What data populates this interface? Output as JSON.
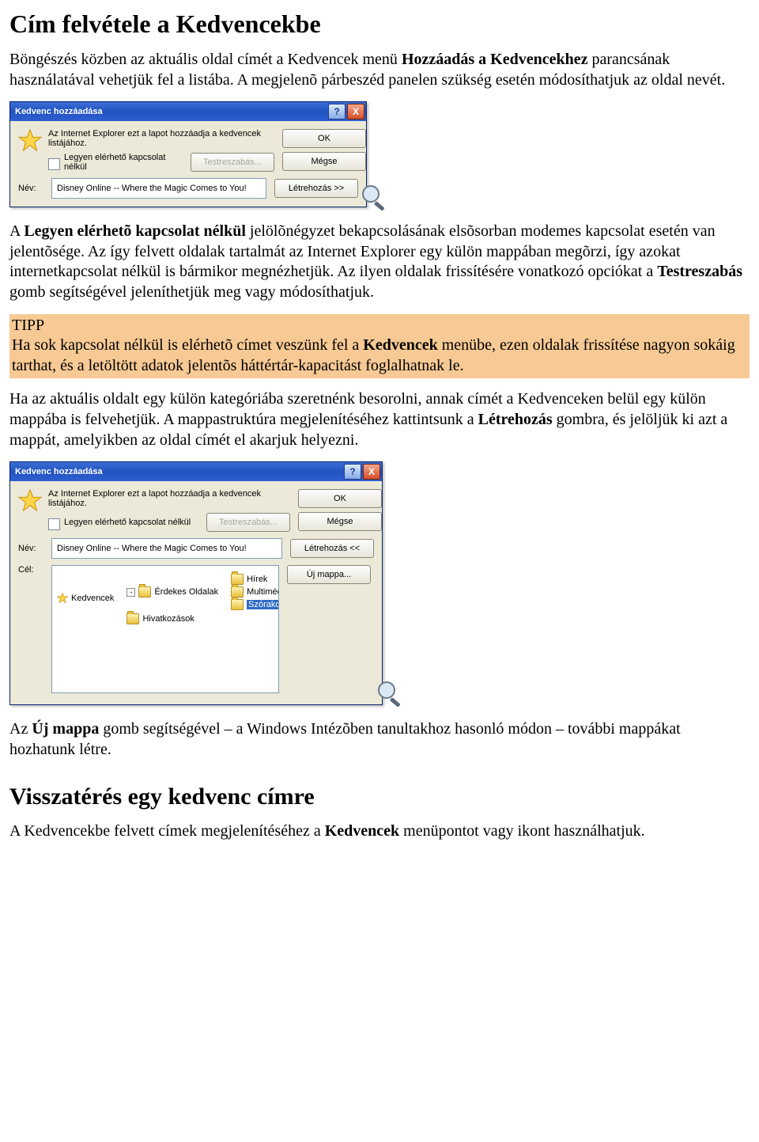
{
  "heading1": "Cím felvétele a Kedvencekbe",
  "para1_a": "Böngészés közben az aktuális oldal címét a Kedvencek menü ",
  "para1_b": "Hozzáadás a Kedvencekhez",
  "para1_c": " parancsának használatával vehetjük fel a listába. A megjelenõ párbeszéd panelen szükség esetén módosíthatjuk az oldal nevét.",
  "para2_a": "A ",
  "para2_b": "Legyen elérhetõ kapcsolat nélkül",
  "para2_c": " jelölõnégyzet bekapcsolásának elsõsorban modemes kapcsolat esetén van jelentõsége. Az így felvett oldalak tartalmát az Internet Explorer egy külön mappában megõrzi, így azokat internetkapcsolat nélkül is bármikor megnézhetjük. Az ilyen oldalak frissítésére vonatkozó opciókat a ",
  "para2_d": "Testreszabás",
  "para2_e": " gomb segítségével jeleníthetjük meg vagy módosíthatjuk.",
  "tip_label": "TIPP",
  "tip_a": "Ha sok kapcsolat nélkül is elérhetõ címet veszünk fel a ",
  "tip_b": "Kedvencek",
  "tip_c": " menübe, ezen oldalak frissítése nagyon sokáig tarthat, és a letöltött adatok jelentõs háttértár-kapacitást foglalhatnak le.",
  "para3_a": "Ha az aktuális oldalt egy külön kategóriába szeretnénk besorolni, annak címét a Kedvenceken belül egy külön mappába is felvehetjük. A mappastruktúra megjelenítéséhez kattintsunk a ",
  "para3_b": "Létrehozás",
  "para3_c": " gombra, és jelöljük ki azt a mappát, amelyikben az oldal címét el akarjuk helyezni.",
  "para4_a": "Az ",
  "para4_b": "Új mappa",
  "para4_c": " gomb segítségével – a Windows Intézõben tanultakhoz hasonló módon – további mappákat hozhatunk létre.",
  "heading2": "Visszatérés egy kedvenc címre",
  "para5_a": "A Kedvencekbe felvett címek megjelenítéséhez a ",
  "para5_b": "Kedvencek",
  "para5_c": " menüpontot vagy ikont használhatjuk.",
  "dialog": {
    "title": "Kedvenc hozzáadása",
    "help_glyph": "?",
    "close_glyph": "X",
    "intro": "Az Internet Explorer ezt a lapot hozzáadja a kedvencek listájához.",
    "offline_label": "Legyen elérhető kapcsolat nélkül",
    "customize": "Testreszabás...",
    "ok": "OK",
    "cancel": "Mégse",
    "create_expand": "Létrehozás >>",
    "create_collapse": "Létrehozás <<",
    "name_label": "Név:",
    "name_value": "Disney Online -- Where the Magic Comes to You!",
    "target_label": "Cél:",
    "new_folder": "Új mappa...",
    "tree": {
      "root": "Kedvencek",
      "n1": "Érdekes Oldalak",
      "n1a": "Hírek",
      "n1b": "Multimédia",
      "n1c_sel": "Szórakozás",
      "n2": "Hivatkozások"
    },
    "toggle_minus": "-"
  }
}
